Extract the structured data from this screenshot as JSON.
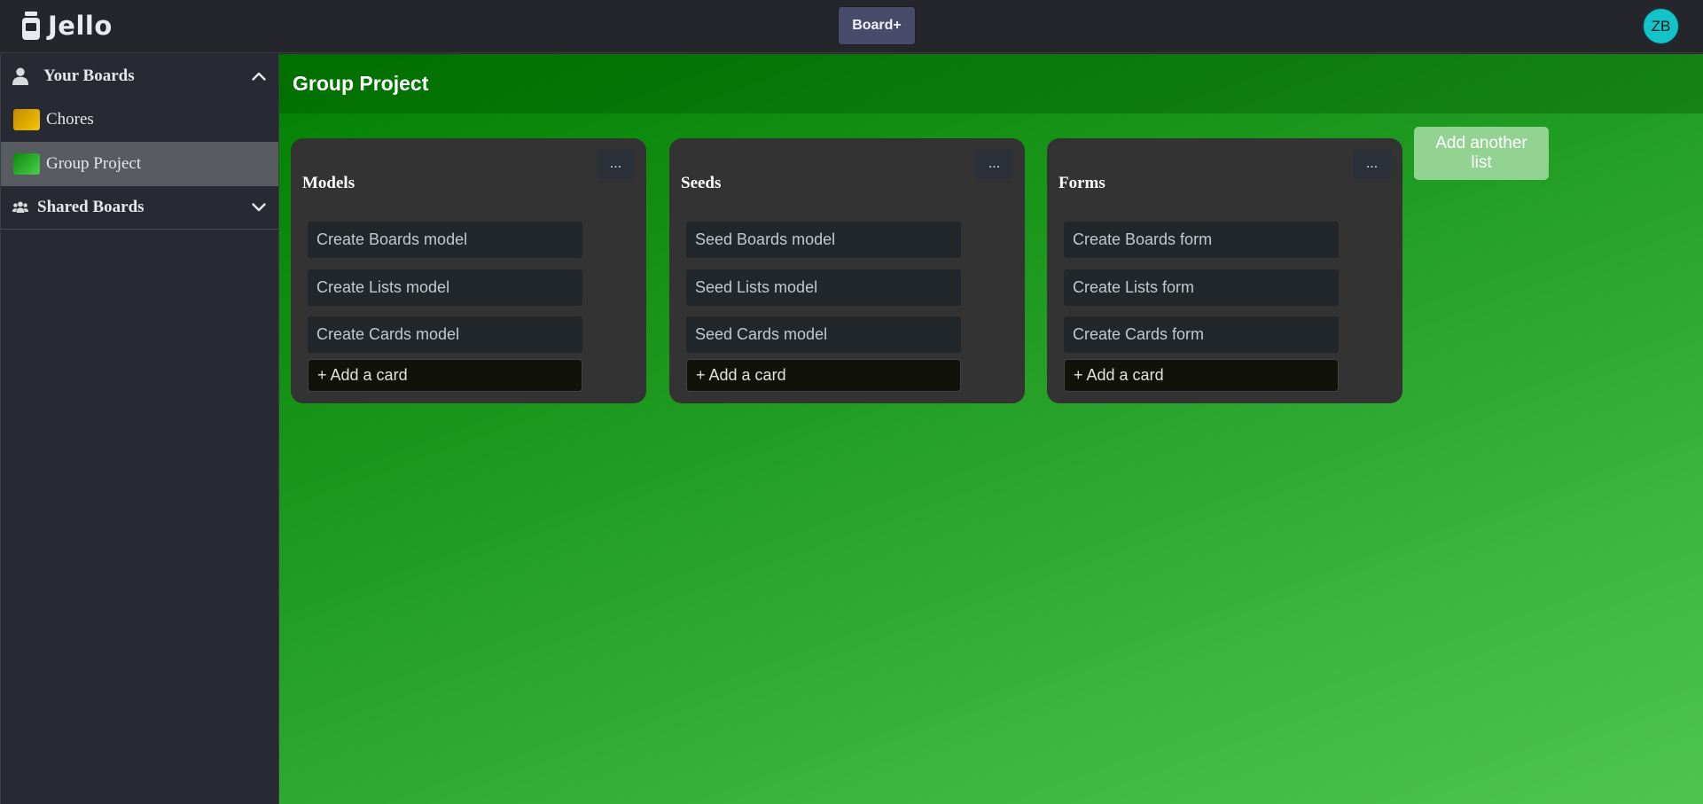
{
  "app": {
    "name": "Jello",
    "logo_icon": "jar-icon"
  },
  "topbar": {
    "board_plus_label": "Board+",
    "avatar_initials": "ZB",
    "avatar_color": "#14c3c8"
  },
  "sidebar": {
    "your_boards": {
      "label": "Your Boards",
      "icon": "user-icon",
      "chevron": "chevron-up-icon",
      "expanded": true,
      "items": [
        {
          "label": "Chores",
          "swatch_color": "#e0a800",
          "active": false
        },
        {
          "label": "Group Project",
          "swatch_color": "#2db92d",
          "active": true
        }
      ]
    },
    "shared_boards": {
      "label": "Shared Boards",
      "icon": "users-icon",
      "chevron": "chevron-down-icon",
      "expanded": false
    }
  },
  "board": {
    "title": "Group Project",
    "background_color": "#1f9a20",
    "lists": [
      {
        "title": "Models",
        "menu_label": "...",
        "cards": [
          "Create Boards model",
          "Create Lists model",
          "Create Cards model"
        ],
        "add_card_label": "+ Add a card"
      },
      {
        "title": "Seeds",
        "menu_label": "...",
        "cards": [
          "Seed Boards model",
          "Seed Lists model",
          "Seed Cards model"
        ],
        "add_card_label": "+ Add a card"
      },
      {
        "title": "Forms",
        "menu_label": "...",
        "cards": [
          "Create Boards form",
          "Create Lists form",
          "Create Cards form"
        ],
        "add_card_label": "+ Add a card"
      }
    ],
    "add_list_label": "Add another list"
  }
}
